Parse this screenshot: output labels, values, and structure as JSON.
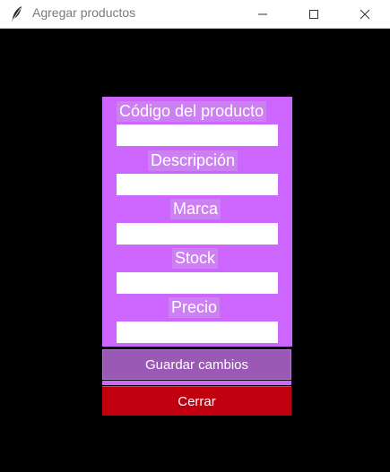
{
  "window": {
    "title": "Agregar productos",
    "icon": "feather-icon"
  },
  "form": {
    "fields": [
      {
        "label": "Código del producto",
        "value": ""
      },
      {
        "label": "Descripción",
        "value": ""
      },
      {
        "label": "Marca",
        "value": ""
      },
      {
        "label": "Stock",
        "value": ""
      },
      {
        "label": "Precio",
        "value": ""
      }
    ],
    "save_label": "Guardar cambios",
    "close_label": "Cerrar"
  },
  "colors": {
    "background": "#000000",
    "panel": "#cc66ff",
    "label_bg": "#cc80f2",
    "save_button": "#9b59b6",
    "close_button": "#c0000f"
  }
}
